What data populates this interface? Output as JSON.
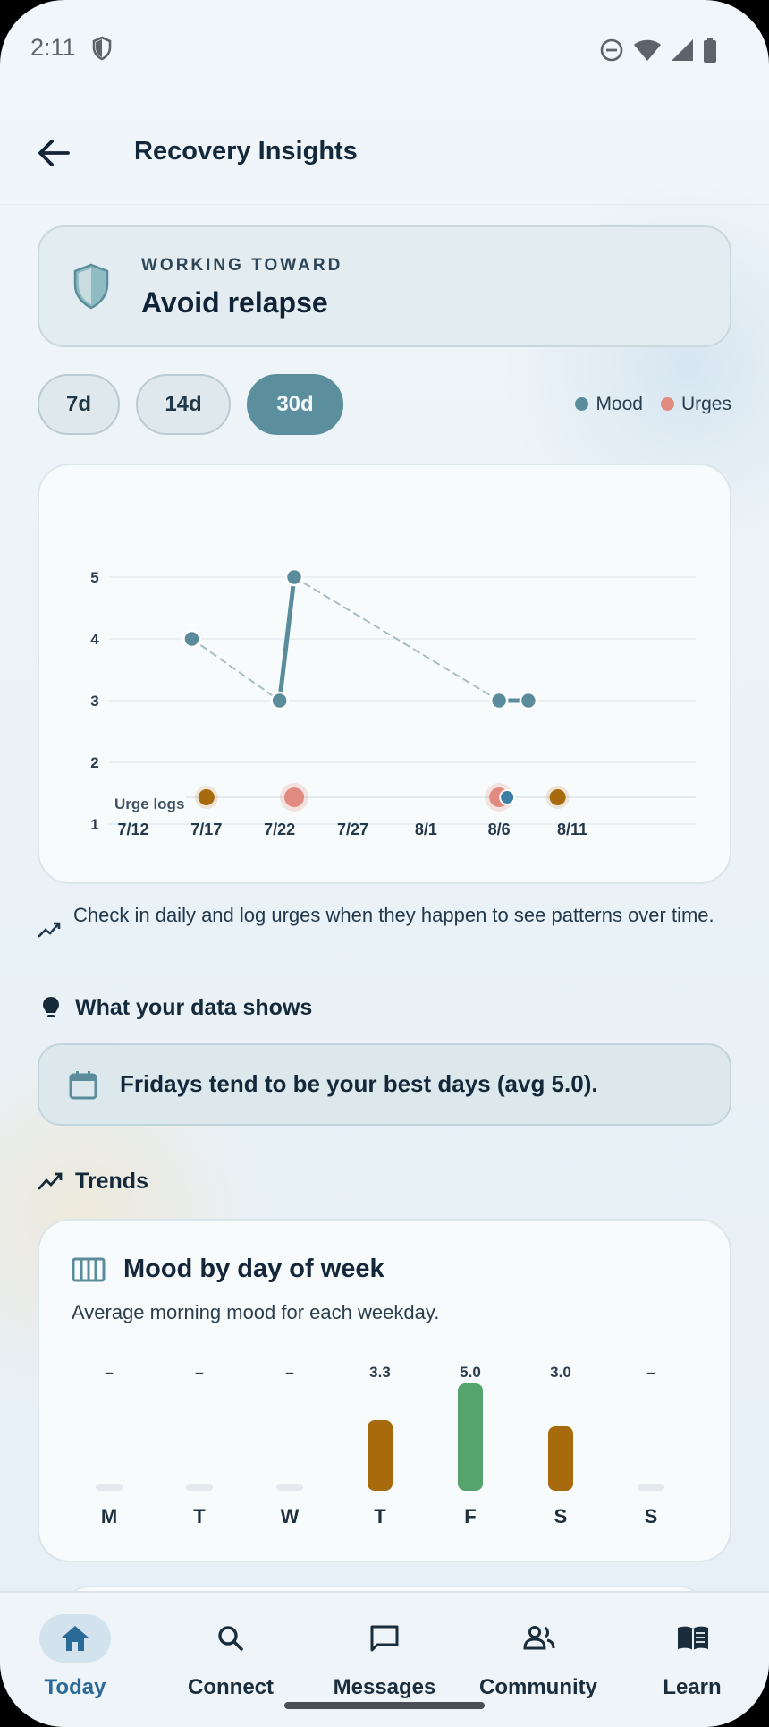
{
  "status_bar": {
    "time": "2:11"
  },
  "header": {
    "title": "Recovery Insights"
  },
  "goal": {
    "kicker": "WORKING TOWARD",
    "text": "Avoid relapse"
  },
  "ranges": [
    {
      "label": "7d",
      "active": false
    },
    {
      "label": "14d",
      "active": false
    },
    {
      "label": "30d",
      "active": true
    }
  ],
  "legend": {
    "mood": "Mood",
    "urges": "Urges"
  },
  "colors": {
    "mood": "#5b8c9b",
    "urge_severe": "#e08a80",
    "urge_moderate": "#a76b0d",
    "good_bar": "#55a46e",
    "accent": "#2a6a98"
  },
  "chart_data": {
    "type": "line",
    "x_ticks": [
      "7/12",
      "7/17",
      "7/22",
      "7/27",
      "8/1",
      "8/6",
      "8/11"
    ],
    "y_ticks": [
      1,
      2,
      3,
      4,
      5
    ],
    "ylim": [
      1,
      5
    ],
    "xlim": [
      "7/12",
      "8/11"
    ],
    "series": [
      {
        "name": "Mood",
        "points": [
          [
            "7/16",
            4
          ],
          [
            "7/22",
            3
          ],
          [
            "7/23",
            5
          ],
          [
            "8/6",
            3
          ],
          [
            "8/8",
            3
          ]
        ]
      }
    ],
    "urge_row_label": "Urge logs",
    "urge_logs": [
      {
        "date": "7/17",
        "severity": "moderate"
      },
      {
        "date": "7/23",
        "severity": "severe"
      },
      {
        "date": "8/6",
        "severity": "severe"
      },
      {
        "date": "8/10",
        "severity": "moderate"
      }
    ],
    "grid": true
  },
  "hint": "Check in daily and log urges when they happen to see patterns over time.",
  "data_section": {
    "title": "What your data shows"
  },
  "insight": {
    "text": "Fridays tend to be your best days (avg 5.0)."
  },
  "trends_section": {
    "title": "Trends"
  },
  "week_card": {
    "title": "Mood by day of week",
    "subtitle": "Average morning mood for each weekday.",
    "days": [
      {
        "day": "M",
        "label": "–",
        "value": null
      },
      {
        "day": "T",
        "label": "–",
        "value": null
      },
      {
        "day": "W",
        "label": "–",
        "value": null
      },
      {
        "day": "T",
        "label": "3.3",
        "value": 3.3
      },
      {
        "day": "F",
        "label": "5.0",
        "value": 5.0
      },
      {
        "day": "S",
        "label": "3.0",
        "value": 3.0
      },
      {
        "day": "S",
        "label": "–",
        "value": null
      }
    ]
  },
  "nav": [
    {
      "label": "Today",
      "icon": "home-icon",
      "active": true
    },
    {
      "label": "Connect",
      "icon": "search-icon",
      "active": false
    },
    {
      "label": "Messages",
      "icon": "message-icon",
      "active": false
    },
    {
      "label": "Community",
      "icon": "people-icon",
      "active": false
    },
    {
      "label": "Learn",
      "icon": "book-icon",
      "active": false
    }
  ]
}
